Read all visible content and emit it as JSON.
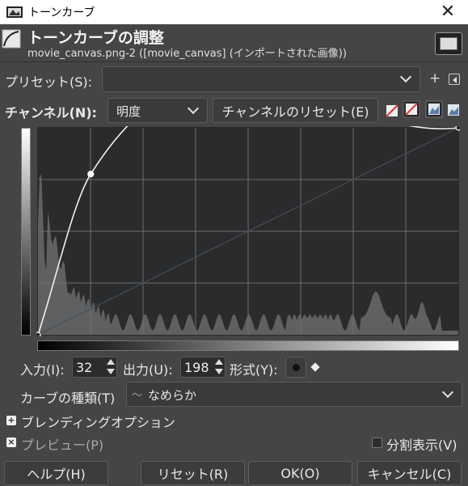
{
  "window": {
    "title": "トーンカーブ",
    "close_glyph": "✕"
  },
  "header": {
    "title": "トーンカーブの調整",
    "subtitle": "movie_canvas.png-2 ([movie_canvas] (インポートされた画像))"
  },
  "preset": {
    "label": "プリセット(S):",
    "value": "",
    "add_glyph": "+"
  },
  "channel": {
    "label": "チャンネル(N):",
    "value": "明度",
    "reset_label": "チャンネルのリセット(E)"
  },
  "curve": {
    "points": [
      {
        "input": 0,
        "output": 0
      },
      {
        "input": 32,
        "output": 198
      },
      {
        "input": 255,
        "output": 255
      }
    ],
    "histogram_color": "#6a6a6a",
    "curve_color": "#f0f0f0",
    "diagonal_color": "#3b4f66"
  },
  "io": {
    "input_label": "入力(I):",
    "input_value": "32",
    "output_label": "出力(U):",
    "output_value": "198",
    "format_label": "形式(Y):"
  },
  "curve_type": {
    "label": "カーブの種類(T)",
    "icon_glyph": "〜",
    "value": "なめらか"
  },
  "blending": {
    "label": "ブレンディングオプション",
    "expander_glyph": "+"
  },
  "preview": {
    "label": "プレビュー(P)",
    "checked": true,
    "check_glyph": "×"
  },
  "split_view": {
    "label": "分割表示(V)",
    "checked": false
  },
  "buttons": {
    "help": "ヘルプ(H)",
    "reset": "リセット(R)",
    "ok": "OK(O)",
    "cancel": "キャンセル(C)"
  },
  "colors": {
    "background": "#454545",
    "titlebar": "#ffffff",
    "field": "#3a3a3a"
  }
}
